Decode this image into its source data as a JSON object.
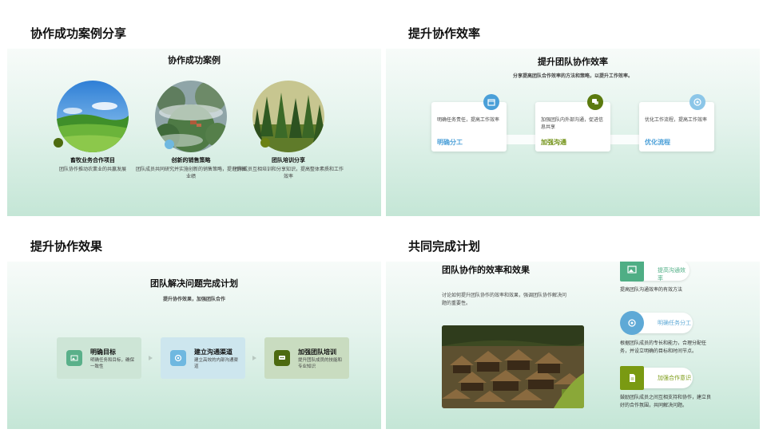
{
  "slides": [
    {
      "heading": "协作成功案例分享",
      "title": "协作成功案例",
      "cases": [
        {
          "title": "畜牧业务合作项目",
          "desc": "团队协作推动农業业的共赢发展"
        },
        {
          "title": "创新的销售策略",
          "desc": "团队成员共同研究并实施创新的销售策略，提升销售业绩"
        },
        {
          "title": "团队培训分享",
          "desc": "团队成员互相培训和分享知识，提高整体素质和工作效率"
        }
      ]
    },
    {
      "heading": "提升协作效率",
      "title": "提升团队协作效率",
      "subtitle": "分享提高团队合作效率的方法和策略，以提升工作效率。",
      "cards": [
        {
          "text": "明确任务责任，提高工作效率",
          "label": "明确分工",
          "color": "#4a9fd8",
          "icon": "calendar-icon"
        },
        {
          "text": "加强团队内外部沟通，促进信息共享",
          "label": "加强沟通",
          "color": "#6e8f10",
          "icon": "chat-icon"
        },
        {
          "text": "优化工作流程，提高工作效率",
          "label": "优化流程",
          "color": "#4a9fd8",
          "icon": "target-icon"
        }
      ]
    },
    {
      "heading": "提升协作效果",
      "title": "团队解决问题完成计划",
      "subtitle": "提升协作效果，加强团队合作",
      "steps": [
        {
          "title": "明确目标",
          "desc": "明确任务和目标，确保一致性",
          "bg": "#cde5d6",
          "iconbg": "#5ab08a",
          "icon": "image-icon"
        },
        {
          "title": "建立沟通渠道",
          "desc": "建立高效的内部沟通渠道",
          "bg": "#cde6ee",
          "iconbg": "#6fb8e0",
          "icon": "target-icon"
        },
        {
          "title": "加强团队培训",
          "desc": "提升团队成员的技能和专业知识",
          "bg": "#c9dcc0",
          "iconbg": "#4d6a10",
          "icon": "chat-icon"
        }
      ]
    },
    {
      "heading": "共同完成计划",
      "title": "团队协作的效率和效果",
      "desc": "讨论如何提升团队协作的效率和效果，强调团队协作解决问题的重要性。",
      "items": [
        {
          "label": "提高沟通效率",
          "desc": "提高团队沟通效率的有效方法",
          "color": "#4fae85",
          "icon": "image-icon"
        },
        {
          "label": "明确任务分工",
          "desc": "根据团队成员的专长和能力，合理分配任务，并设立明确的目标和时间节点。",
          "color": "#5ea9d6",
          "icon": "target-icon"
        },
        {
          "label": "加强合作意识",
          "desc": "鼓励团队成员之间互相支持和协作，建立良好的合作氛围，共同解决问题。",
          "color": "#7a9a12",
          "icon": "document-icon"
        }
      ]
    }
  ]
}
